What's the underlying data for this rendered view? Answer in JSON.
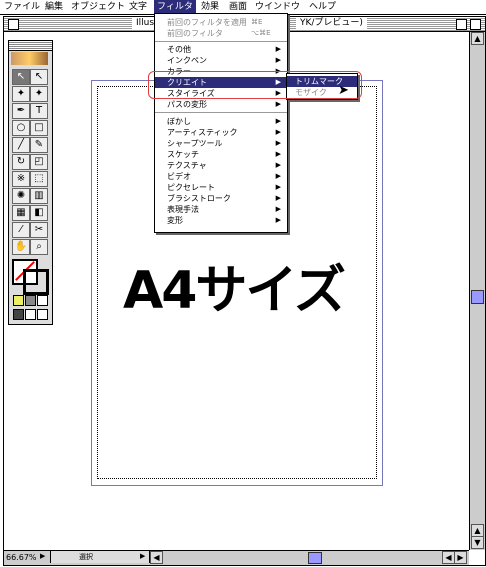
{
  "menubar": {
    "items": [
      "ファイル",
      "編集",
      "オブジェクト",
      "文字",
      "フィルタ",
      "効果",
      "画面",
      "ウインドウ",
      "ヘルプ"
    ]
  },
  "window": {
    "title_left": "Illus",
    "title_right": "YK/プレビュー)"
  },
  "filter_menu": {
    "recent": [
      {
        "label": "前回のフィルタを適用",
        "shortcut": "⌘E"
      },
      {
        "label": "前回のフィルタ",
        "shortcut": "⌥⌘E"
      }
    ],
    "group1": [
      "その他",
      "インクペン",
      "カラー",
      "クリエイト",
      "スタイライズ",
      "パスの変形"
    ],
    "group2": [
      "ぼかし",
      "アーティスティック",
      "シャープツール",
      "スケッチ",
      "テクスチャ",
      "ビデオ",
      "ピクセレート",
      "ブラシストローク",
      "表現手法",
      "変形"
    ],
    "highlighted": "クリエイト"
  },
  "submenu": {
    "items": [
      "トリムマーク",
      "モザイク"
    ]
  },
  "canvas": {
    "big_text": "A4サイズ"
  },
  "status": {
    "zoom": "66.67%",
    "mode": "選択"
  },
  "colors": {
    "menu_highlight": "#2c2c7a",
    "annotation_red": "#e04040"
  }
}
